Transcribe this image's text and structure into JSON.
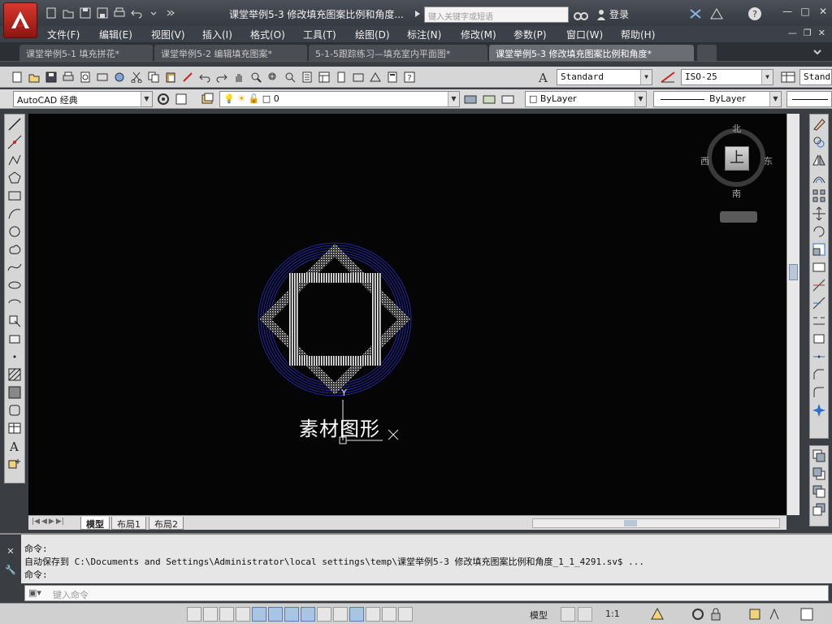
{
  "app": {
    "title": "课堂举例5-3 修改填充图案比例和角度...",
    "search_placeholder": "键入关键字或短语",
    "login": "登录",
    "brand_color": "#c8281e"
  },
  "menu": [
    "文件(F)",
    "编辑(E)",
    "视图(V)",
    "插入(I)",
    "格式(O)",
    "工具(T)",
    "绘图(D)",
    "标注(N)",
    "修改(M)",
    "参数(P)",
    "窗口(W)",
    "帮助(H)"
  ],
  "doc_tabs": [
    {
      "label": "课堂举例5-1 填充拼花*",
      "active": false
    },
    {
      "label": "课堂举例5-2 编辑填充图案*",
      "active": false
    },
    {
      "label": "5-1-5跟踪练习—填充室内平面图*",
      "active": false
    },
    {
      "label": "课堂举例5-3 修改填充图案比例和角度*",
      "active": true
    }
  ],
  "toolbar": {
    "text_style": "Standard",
    "dim_style": "ISO-25",
    "table_style": "Standa",
    "workspace": "AutoCAD 经典",
    "layer": "0",
    "color": "ByLayer",
    "linetype": "ByLayer"
  },
  "canvas": {
    "background": "#050505",
    "label": "素材图形",
    "ucs_y": "Y",
    "viewcube": {
      "north": "北",
      "south": "南",
      "east": "东",
      "west": "西",
      "face": "上"
    }
  },
  "layout_tabs": [
    {
      "label": "模型",
      "active": true
    },
    {
      "label": "布局1",
      "active": false
    },
    {
      "label": "布局2",
      "active": false
    }
  ],
  "command": {
    "lines": [
      "命令:",
      "自动保存到 C:\\Documents and Settings\\Administrator\\local settings\\temp\\课堂举例5-3 修改填充图案比例和角度_1_1_4291.sv$ ...",
      "命令:"
    ],
    "input_placeholder": "键入命令"
  },
  "status": {
    "model_label": "模型",
    "scale": "1:1"
  }
}
